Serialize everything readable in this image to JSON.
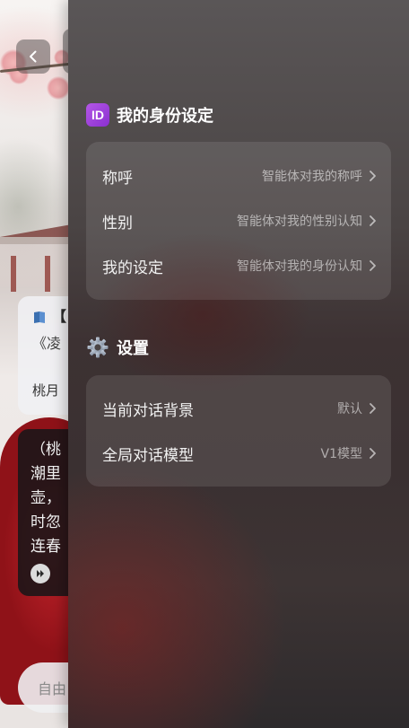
{
  "background_chat": {
    "card": {
      "title_fragment": "【",
      "subtitle_fragment": "《凌",
      "author_fragment": "桃月"
    },
    "message_lines": [
      "（桃",
      "潮里",
      "壶，",
      "时忽",
      "连春"
    ],
    "input_placeholder": "自由"
  },
  "drawer": {
    "identity_section": {
      "icon": "id-icon",
      "title": "我的身份设定",
      "rows": [
        {
          "label": "称呼",
          "value": "智能体对我的称呼"
        },
        {
          "label": "性别",
          "value": "智能体对我的性别认知"
        },
        {
          "label": "我的设定",
          "value": "智能体对我的身份认知"
        }
      ]
    },
    "settings_section": {
      "icon": "gear-icon",
      "title": "设置",
      "rows": [
        {
          "label": "当前对话背景",
          "value": "默认"
        },
        {
          "label": "全局对话模型",
          "value": "V1模型"
        }
      ]
    }
  },
  "colors": {
    "id_icon": "#9b3fdc",
    "accent_red": "#b5222a"
  }
}
